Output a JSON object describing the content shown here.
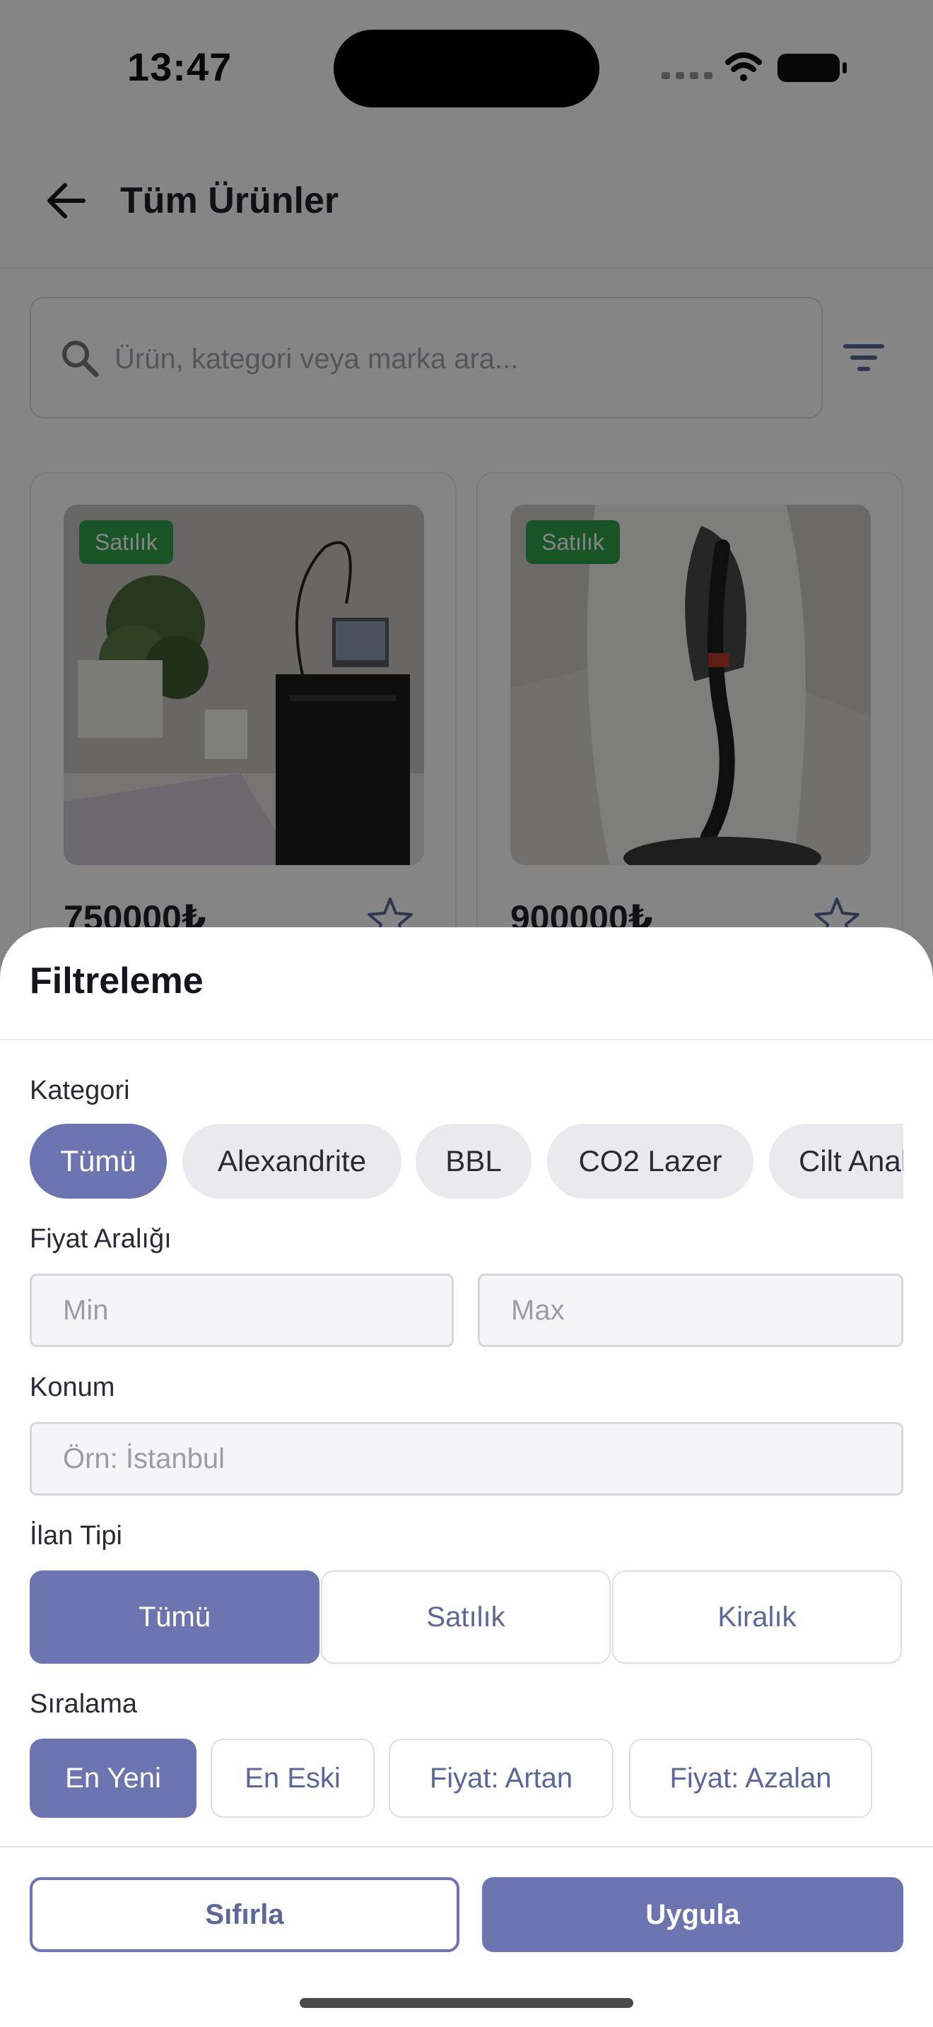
{
  "status_bar": {
    "time": "13:47"
  },
  "header": {
    "title": "Tüm Ürünler",
    "back_icon": "arrow-left-icon"
  },
  "search": {
    "placeholder": "Ürün, kategori veya marka ara...",
    "value": "",
    "icon": "search-icon",
    "filter_icon": "filter-icon"
  },
  "products": [
    {
      "badge": "Satılık",
      "price": "750000₺",
      "favorite_icon": "star-outline-icon"
    },
    {
      "badge": "Satılık",
      "price": "900000₺",
      "favorite_icon": "star-outline-icon"
    }
  ],
  "filter_sheet": {
    "title": "Filtreleme",
    "category": {
      "label": "Kategori",
      "options": [
        "Tümü",
        "Alexandrite",
        "BBL",
        "CO2 Lazer",
        "Cilt Analiz"
      ],
      "selected": "Tümü"
    },
    "price_range": {
      "label": "Fiyat Aralığı",
      "min_placeholder": "Min",
      "max_placeholder": "Max",
      "min_value": "",
      "max_value": ""
    },
    "location": {
      "label": "Konum",
      "placeholder": "Örn: İstanbul",
      "value": ""
    },
    "listing_type": {
      "label": "İlan Tipi",
      "options": [
        "Tümü",
        "Satılık",
        "Kiralık"
      ],
      "selected": "Tümü"
    },
    "sorting": {
      "label": "Sıralama",
      "options": [
        "En Yeni",
        "En Eski",
        "Fiyat: Artan",
        "Fiyat: Azalan"
      ],
      "selected": "En Yeni"
    },
    "reset_label": "Sıfırla",
    "apply_label": "Uygula"
  },
  "colors": {
    "accent": "#6c75b0",
    "badge_green": "#2fa14a",
    "overlay": "rgba(0,0,0,0.48)"
  }
}
